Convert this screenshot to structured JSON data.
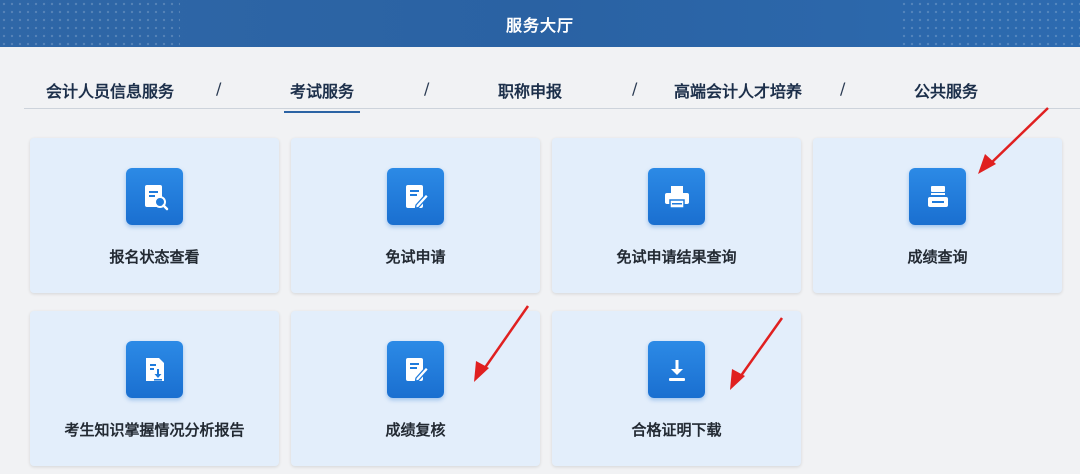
{
  "header": {
    "title": "服务大厅"
  },
  "tabs": [
    {
      "label": "会计人员信息服务"
    },
    {
      "label": "考试服务"
    },
    {
      "label": "职称申报"
    },
    {
      "label": "高端会计人才培养"
    },
    {
      "label": "公共服务"
    }
  ],
  "tab_separator": "/",
  "active_tab": "考试服务",
  "cards": [
    {
      "label": "报名状态查看",
      "icon": "document-search-icon"
    },
    {
      "label": "免试申请",
      "icon": "edit-document-icon"
    },
    {
      "label": "免试申请结果查询",
      "icon": "printer-icon"
    },
    {
      "label": "成绩查询",
      "icon": "tray-icon"
    },
    {
      "label": "考生知识掌握情况分析报告",
      "icon": "report-download-icon"
    },
    {
      "label": "成绩复核",
      "icon": "edit-document-icon"
    },
    {
      "label": "合格证明下载",
      "icon": "download-icon"
    }
  ],
  "colors": {
    "header": "#2b63a4",
    "card_bg": "#e3eefb",
    "icon_bg": "#1f7bdc",
    "annotation_arrow": "#e02020"
  }
}
